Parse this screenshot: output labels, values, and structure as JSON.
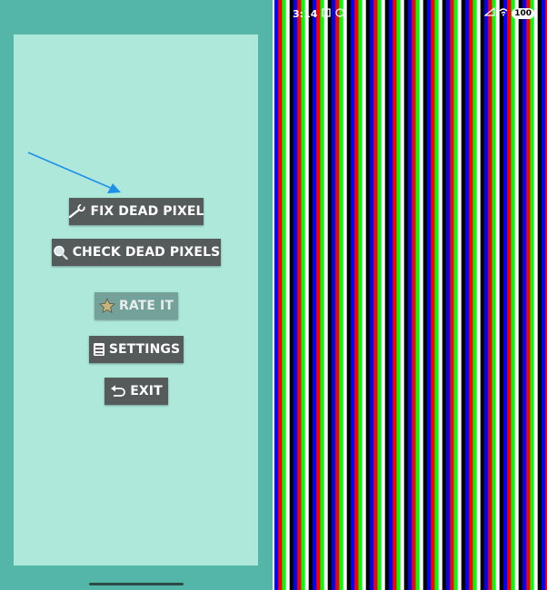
{
  "app": {
    "buttons": {
      "fix_dead_pixel": "FIX DEAD PIXEL",
      "check_dead_pixels": "CHECK DEAD PIXELS",
      "rate_it": "RATE IT",
      "settings": "SETTINGS",
      "exit": "EXIT"
    },
    "icons": {
      "fix": "wrench-icon",
      "check": "magnifier-icon",
      "rate": "star-icon",
      "settings": "settings-icon",
      "exit": "undo-icon"
    },
    "colors": {
      "background": "#53b6a8",
      "panel": "#ade8db",
      "button": "#555b5b",
      "button_disabled": "#74a19a",
      "annotation_arrow": "#1e90e8"
    }
  },
  "status_bar": {
    "time": "3:14",
    "battery": "100"
  },
  "test_screen": {
    "stripe_pattern": [
      "#0000ff",
      "#ff0000",
      "#00ff00",
      "#ffffff",
      "#000000"
    ],
    "stripe_colors_named": [
      "blue",
      "red",
      "green",
      "white",
      "black"
    ]
  }
}
